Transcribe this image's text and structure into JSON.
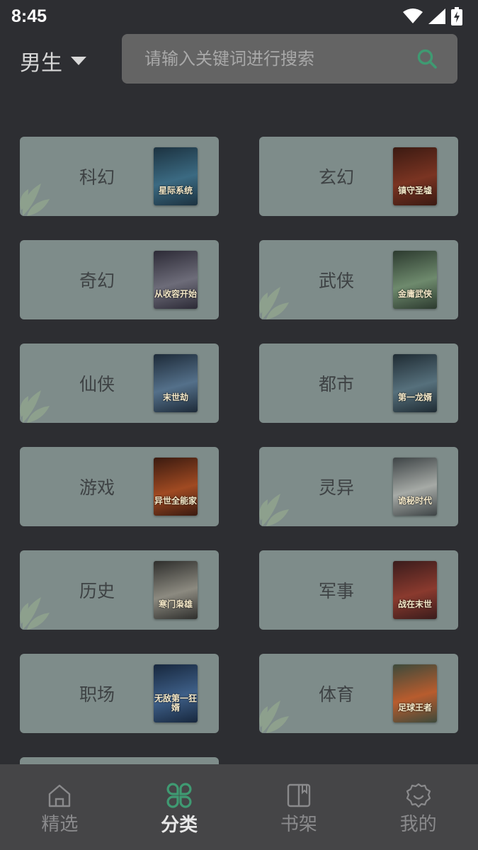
{
  "status_bar": {
    "time": "8:45",
    "icons": [
      "wifi-icon",
      "signal-icon",
      "battery-charging-icon"
    ]
  },
  "gender_selector": {
    "label": "男生",
    "icon": "caret-down-icon"
  },
  "search": {
    "placeholder": "请输入关键词进行搜索",
    "value": "",
    "icon": "search-icon"
  },
  "categories": [
    {
      "name": "科幻",
      "cover_title": "星际系统",
      "cover_colors": [
        "#1c3240",
        "#3b6a82"
      ],
      "leaf": true
    },
    {
      "name": "玄幻",
      "cover_title": "镇守圣墟",
      "cover_colors": [
        "#3b1a12",
        "#7a3422"
      ],
      "leaf": false
    },
    {
      "name": "奇幻",
      "cover_title": "从收容开始",
      "cover_colors": [
        "#2c2a36",
        "#6d6c79"
      ],
      "leaf": false
    },
    {
      "name": "武侠",
      "cover_title": "金庸武侠",
      "cover_colors": [
        "#2c3a2f",
        "#6e8a6d"
      ],
      "leaf": true
    },
    {
      "name": "仙侠",
      "cover_title": "末世劫",
      "cover_colors": [
        "#1d2a38",
        "#54708a"
      ],
      "leaf": true
    },
    {
      "name": "都市",
      "cover_title": "第一龙婿",
      "cover_colors": [
        "#1f2b33",
        "#56707c"
      ],
      "leaf": false
    },
    {
      "name": "游戏",
      "cover_title": "异世全能家",
      "cover_colors": [
        "#3a1a10",
        "#a04a22"
      ],
      "leaf": false
    },
    {
      "name": "灵异",
      "cover_title": "诡秘时代",
      "cover_colors": [
        "#3e4446",
        "#a6aaa6"
      ],
      "leaf": true
    },
    {
      "name": "历史",
      "cover_title": "寒门枭雄",
      "cover_colors": [
        "#2e2e2c",
        "#8c8a80"
      ],
      "leaf": true
    },
    {
      "name": "军事",
      "cover_title": "战在末世",
      "cover_colors": [
        "#3a1c1c",
        "#8a3a2e"
      ],
      "leaf": false
    },
    {
      "name": "职场",
      "cover_title": "无敌第一狂婿",
      "cover_colors": [
        "#17273d",
        "#3e5f88"
      ],
      "leaf": false
    },
    {
      "name": "体育",
      "cover_title": "足球王者",
      "cover_colors": [
        "#3d4a3b",
        "#b85c2e"
      ],
      "leaf": true
    }
  ],
  "bottom_nav": [
    {
      "label": "精选",
      "icon": "home-icon",
      "active": false
    },
    {
      "label": "分类",
      "icon": "category-icon",
      "active": true
    },
    {
      "label": "书架",
      "icon": "bookshelf-icon",
      "active": false
    },
    {
      "label": "我的",
      "icon": "profile-gear-icon",
      "active": false
    }
  ],
  "colors": {
    "background": "#2d2e32",
    "card": "#7e8c8a",
    "accent": "#3f9a72",
    "search_bg": "#646464",
    "nav_bg": "#454547"
  }
}
